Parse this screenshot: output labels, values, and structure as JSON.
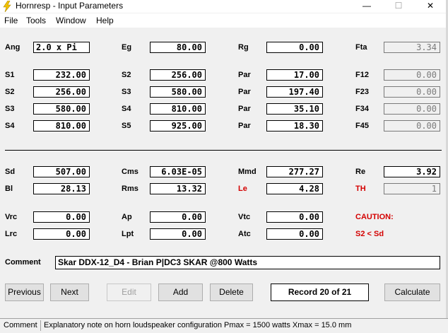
{
  "window": {
    "title": "Hornresp - Input Parameters",
    "minimize": "—",
    "maximize": "☐",
    "close": "✕"
  },
  "menu": [
    "File",
    "Tools",
    "Window",
    "Help"
  ],
  "labels": {
    "ang": "Ang",
    "eg": "Eg",
    "rg": "Rg",
    "fta": "Fta",
    "s1": "S1",
    "s2": "S2",
    "s3": "S3",
    "s4": "S4",
    "s2b": "S2",
    "s3b": "S3",
    "s4b": "S4",
    "s5b": "S5",
    "par": "Par",
    "f12": "F12",
    "f23": "F23",
    "f34": "F34",
    "f45": "F45",
    "sd": "Sd",
    "bl": "Bl",
    "cms": "Cms",
    "rms": "Rms",
    "mmd": "Mmd",
    "le": "Le",
    "re": "Re",
    "th": "TH",
    "vrc": "Vrc",
    "lrc": "Lrc",
    "ap": "Ap",
    "lpt": "Lpt",
    "vtc": "Vtc",
    "atc": "Atc",
    "caution": "CAUTION:",
    "caution_detail": "S2 < Sd",
    "comment": "Comment"
  },
  "values": {
    "ang": "2.0 x Pi",
    "eg": "80.00",
    "rg": "0.00",
    "fta": "3.34",
    "s1": "232.00",
    "s2": "256.00",
    "s3": "580.00",
    "s4": "810.00",
    "s2b": "256.00",
    "s3b": "580.00",
    "s4b": "810.00",
    "s5b": "925.00",
    "par1": "17.00",
    "par2": "197.40",
    "par3": "35.10",
    "par4": "18.30",
    "f12": "0.00",
    "f23": "0.00",
    "f34": "0.00",
    "f45": "0.00",
    "sd": "507.00",
    "bl": "28.13",
    "cms": "6.03E-05",
    "rms": "13.32",
    "mmd": "277.27",
    "le": "4.28",
    "re": "3.92",
    "th": "1",
    "vrc": "0.00",
    "lrc": "0.00",
    "ap": "0.00",
    "lpt": "0.00",
    "vtc": "0.00",
    "atc": "0.00"
  },
  "comment_value": "Skar DDX-12_D4 - Brian P|DC3 SKAR @800 Watts",
  "buttons": {
    "previous": "Previous",
    "next": "Next",
    "edit": "Edit",
    "add": "Add",
    "delete": "Delete",
    "calculate": "Calculate"
  },
  "record": "Record 20 of 21",
  "status": {
    "label": "Comment",
    "text": "Explanatory note on horn loudspeaker configuration   Pmax = 1500 watts   Xmax = 15.0 mm"
  },
  "colors": {
    "accent_red": "#d40000"
  }
}
